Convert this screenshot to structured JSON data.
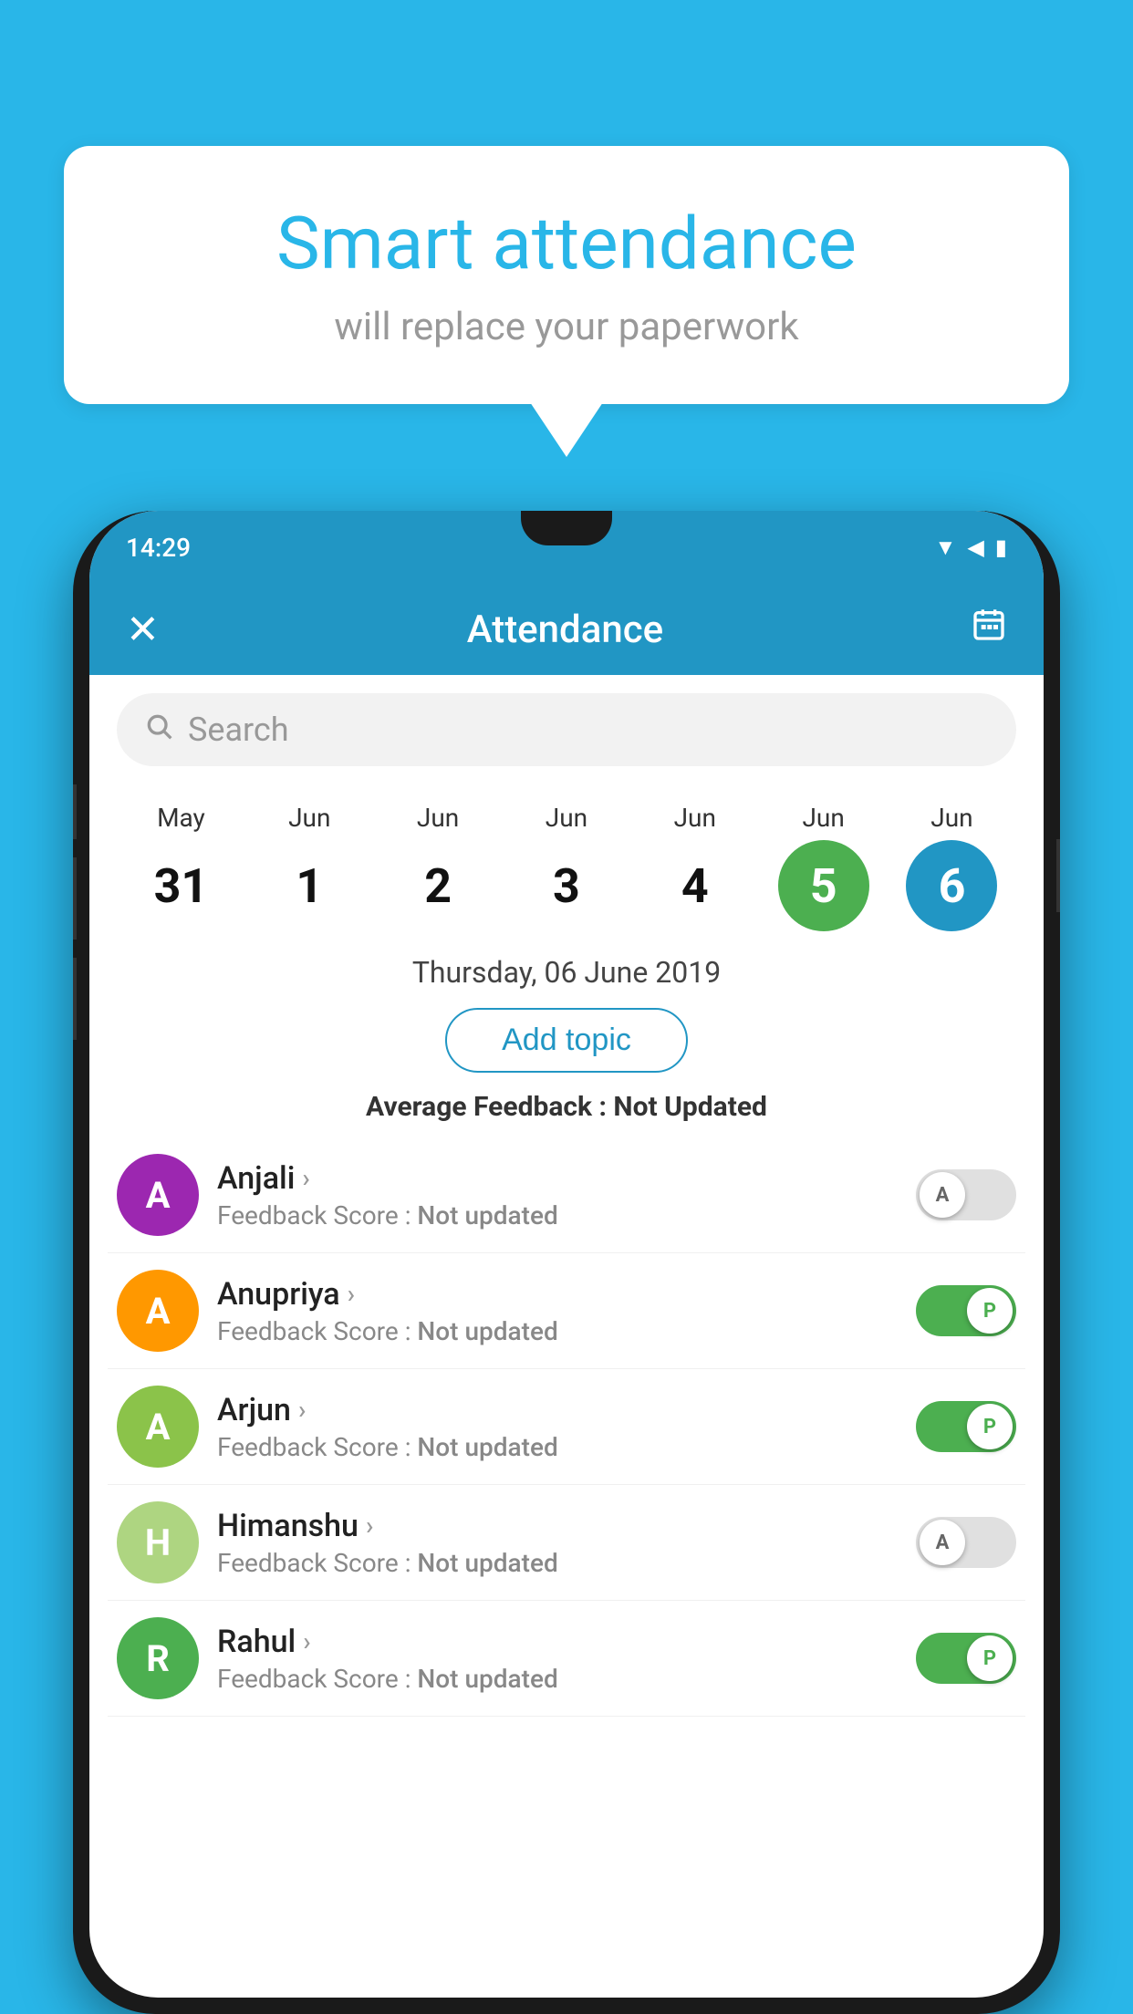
{
  "background_color": "#29b6e8",
  "speech_bubble": {
    "title": "Smart attendance",
    "subtitle": "will replace your paperwork"
  },
  "status_bar": {
    "time": "14:29",
    "icons": [
      "wifi",
      "signal",
      "battery"
    ]
  },
  "header": {
    "title": "Attendance",
    "close_label": "×",
    "calendar_icon": "📅"
  },
  "search": {
    "placeholder": "Search"
  },
  "calendar": {
    "days": [
      {
        "month": "May",
        "date": "31",
        "state": "normal"
      },
      {
        "month": "Jun",
        "date": "1",
        "state": "normal"
      },
      {
        "month": "Jun",
        "date": "2",
        "state": "normal"
      },
      {
        "month": "Jun",
        "date": "3",
        "state": "normal"
      },
      {
        "month": "Jun",
        "date": "4",
        "state": "normal"
      },
      {
        "month": "Jun",
        "date": "5",
        "state": "today"
      },
      {
        "month": "Jun",
        "date": "6",
        "state": "selected"
      }
    ]
  },
  "selected_date_label": "Thursday, 06 June 2019",
  "add_topic_label": "Add topic",
  "avg_feedback_label": "Average Feedback : ",
  "avg_feedback_value": "Not Updated",
  "students": [
    {
      "name": "Anjali",
      "avatar_letter": "A",
      "avatar_color": "#9c27b0",
      "feedback_label": "Feedback Score : ",
      "feedback_value": "Not updated",
      "toggle_state": "off",
      "toggle_label": "A"
    },
    {
      "name": "Anupriya",
      "avatar_letter": "A",
      "avatar_color": "#ff9800",
      "feedback_label": "Feedback Score : ",
      "feedback_value": "Not updated",
      "toggle_state": "on",
      "toggle_label": "P"
    },
    {
      "name": "Arjun",
      "avatar_letter": "A",
      "avatar_color": "#8bc34a",
      "feedback_label": "Feedback Score : ",
      "feedback_value": "Not updated",
      "toggle_state": "on",
      "toggle_label": "P"
    },
    {
      "name": "Himanshu",
      "avatar_letter": "H",
      "avatar_color": "#aed581",
      "feedback_label": "Feedback Score : ",
      "feedback_value": "Not updated",
      "toggle_state": "off",
      "toggle_label": "A"
    },
    {
      "name": "Rahul",
      "avatar_letter": "R",
      "avatar_color": "#4caf50",
      "feedback_label": "Feedback Score : ",
      "feedback_value": "Not updated",
      "toggle_state": "on",
      "toggle_label": "P"
    }
  ]
}
